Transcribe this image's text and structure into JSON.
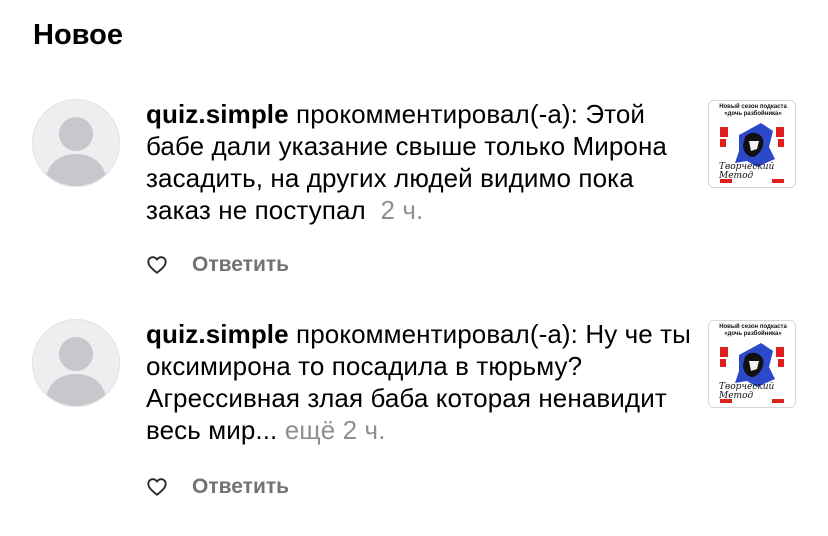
{
  "section": {
    "title": "Новое"
  },
  "notifications": [
    {
      "username": "quiz.simple",
      "action": "прокомментировал(-а):",
      "text": "Этой бабе дали указание свыше только Мирона засадить, на других людей видимо пока заказ не поступал",
      "more": "",
      "time": "2 ч.",
      "reply_label": "Ответить",
      "like_icon": "heart-outline-icon",
      "thumbnail": {
        "caption_line1": "Новый сезон подкаста",
        "caption_line2": "«дочь разбойника»",
        "title": "Творческий Метод",
        "accent_color": "#e0201c",
        "figure_color": "#2c49c9"
      }
    },
    {
      "username": "quiz.simple",
      "action": "прокомментировал(-а):",
      "text": "Ну че ты оксимирона то посадила в тюрьму? Агрессивная злая баба которая ненавидит весь мир...",
      "more": "ещё",
      "time": "2 ч.",
      "reply_label": "Ответить",
      "like_icon": "heart-outline-icon",
      "thumbnail": {
        "caption_line1": "Новый сезон подкаста",
        "caption_line2": "«дочь разбойника»",
        "title": "Творческий Метод",
        "accent_color": "#e0201c",
        "figure_color": "#2c49c9"
      }
    }
  ],
  "colors": {
    "secondary_text": "#8e8e93",
    "reply_text": "#737373",
    "avatar_bg": "#eeeef0",
    "avatar_silhouette": "#c7c7cc"
  }
}
